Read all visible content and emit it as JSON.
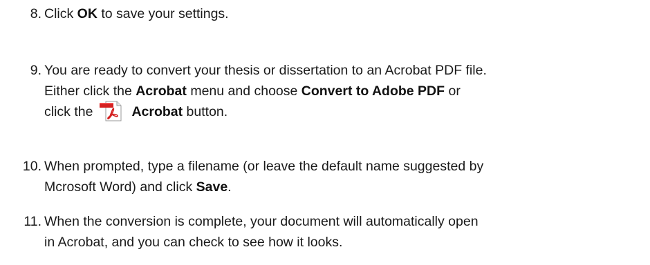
{
  "steps": [
    {
      "number": "8.",
      "lines": [
        {
          "pre": "Click ",
          "bold": "OK",
          "post": " to save your settings."
        }
      ]
    },
    {
      "number": "9.",
      "lines": [
        {
          "text": "You are ready to convert your thesis or dissertation to an Acrobat PDF file."
        },
        {
          "pre": "Either click the ",
          "bold1": "Acrobat",
          "mid": " menu and choose ",
          "bold2": "Convert to Adobe PDF",
          "post": " or"
        },
        {
          "pre": "click the",
          "icon": "acrobat-pdf-icon",
          "bold": "Acrobat",
          "post": " button."
        }
      ]
    },
    {
      "number": "10.",
      "lines": [
        {
          "text": "When prompted, type a filename (or leave the default name suggested by"
        },
        {
          "pre": "Mcrosoft Word) and click ",
          "bold": "Save",
          "post": "."
        }
      ]
    },
    {
      "number": "11.",
      "lines": [
        {
          "text": "When the conversion is complete, your document will automatically open"
        },
        {
          "text": "in Acrobat, and you can check to see how it looks."
        }
      ]
    }
  ],
  "colors": {
    "text": "#1a1a1a",
    "icon_red": "#d42020"
  }
}
